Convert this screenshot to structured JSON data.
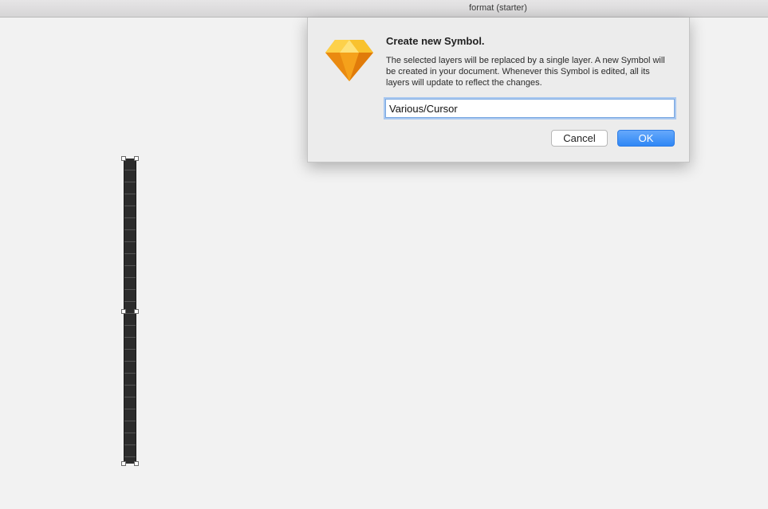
{
  "window": {
    "title": "format (starter)"
  },
  "dialog": {
    "icon": "sketch-diamond-icon",
    "title": "Create new Symbol.",
    "message": "The selected layers will be replaced by a single layer. A new Symbol will be created in your document. Whenever this Symbol is edited, all its layers will update to reflect the changes.",
    "symbol_name_value": "Various/Cursor",
    "cancel_label": "Cancel",
    "ok_label": "OK"
  },
  "colors": {
    "accent": "#2f87f5",
    "canvas": "#f2f2f2",
    "layer_fill": "#2c2c2c"
  }
}
